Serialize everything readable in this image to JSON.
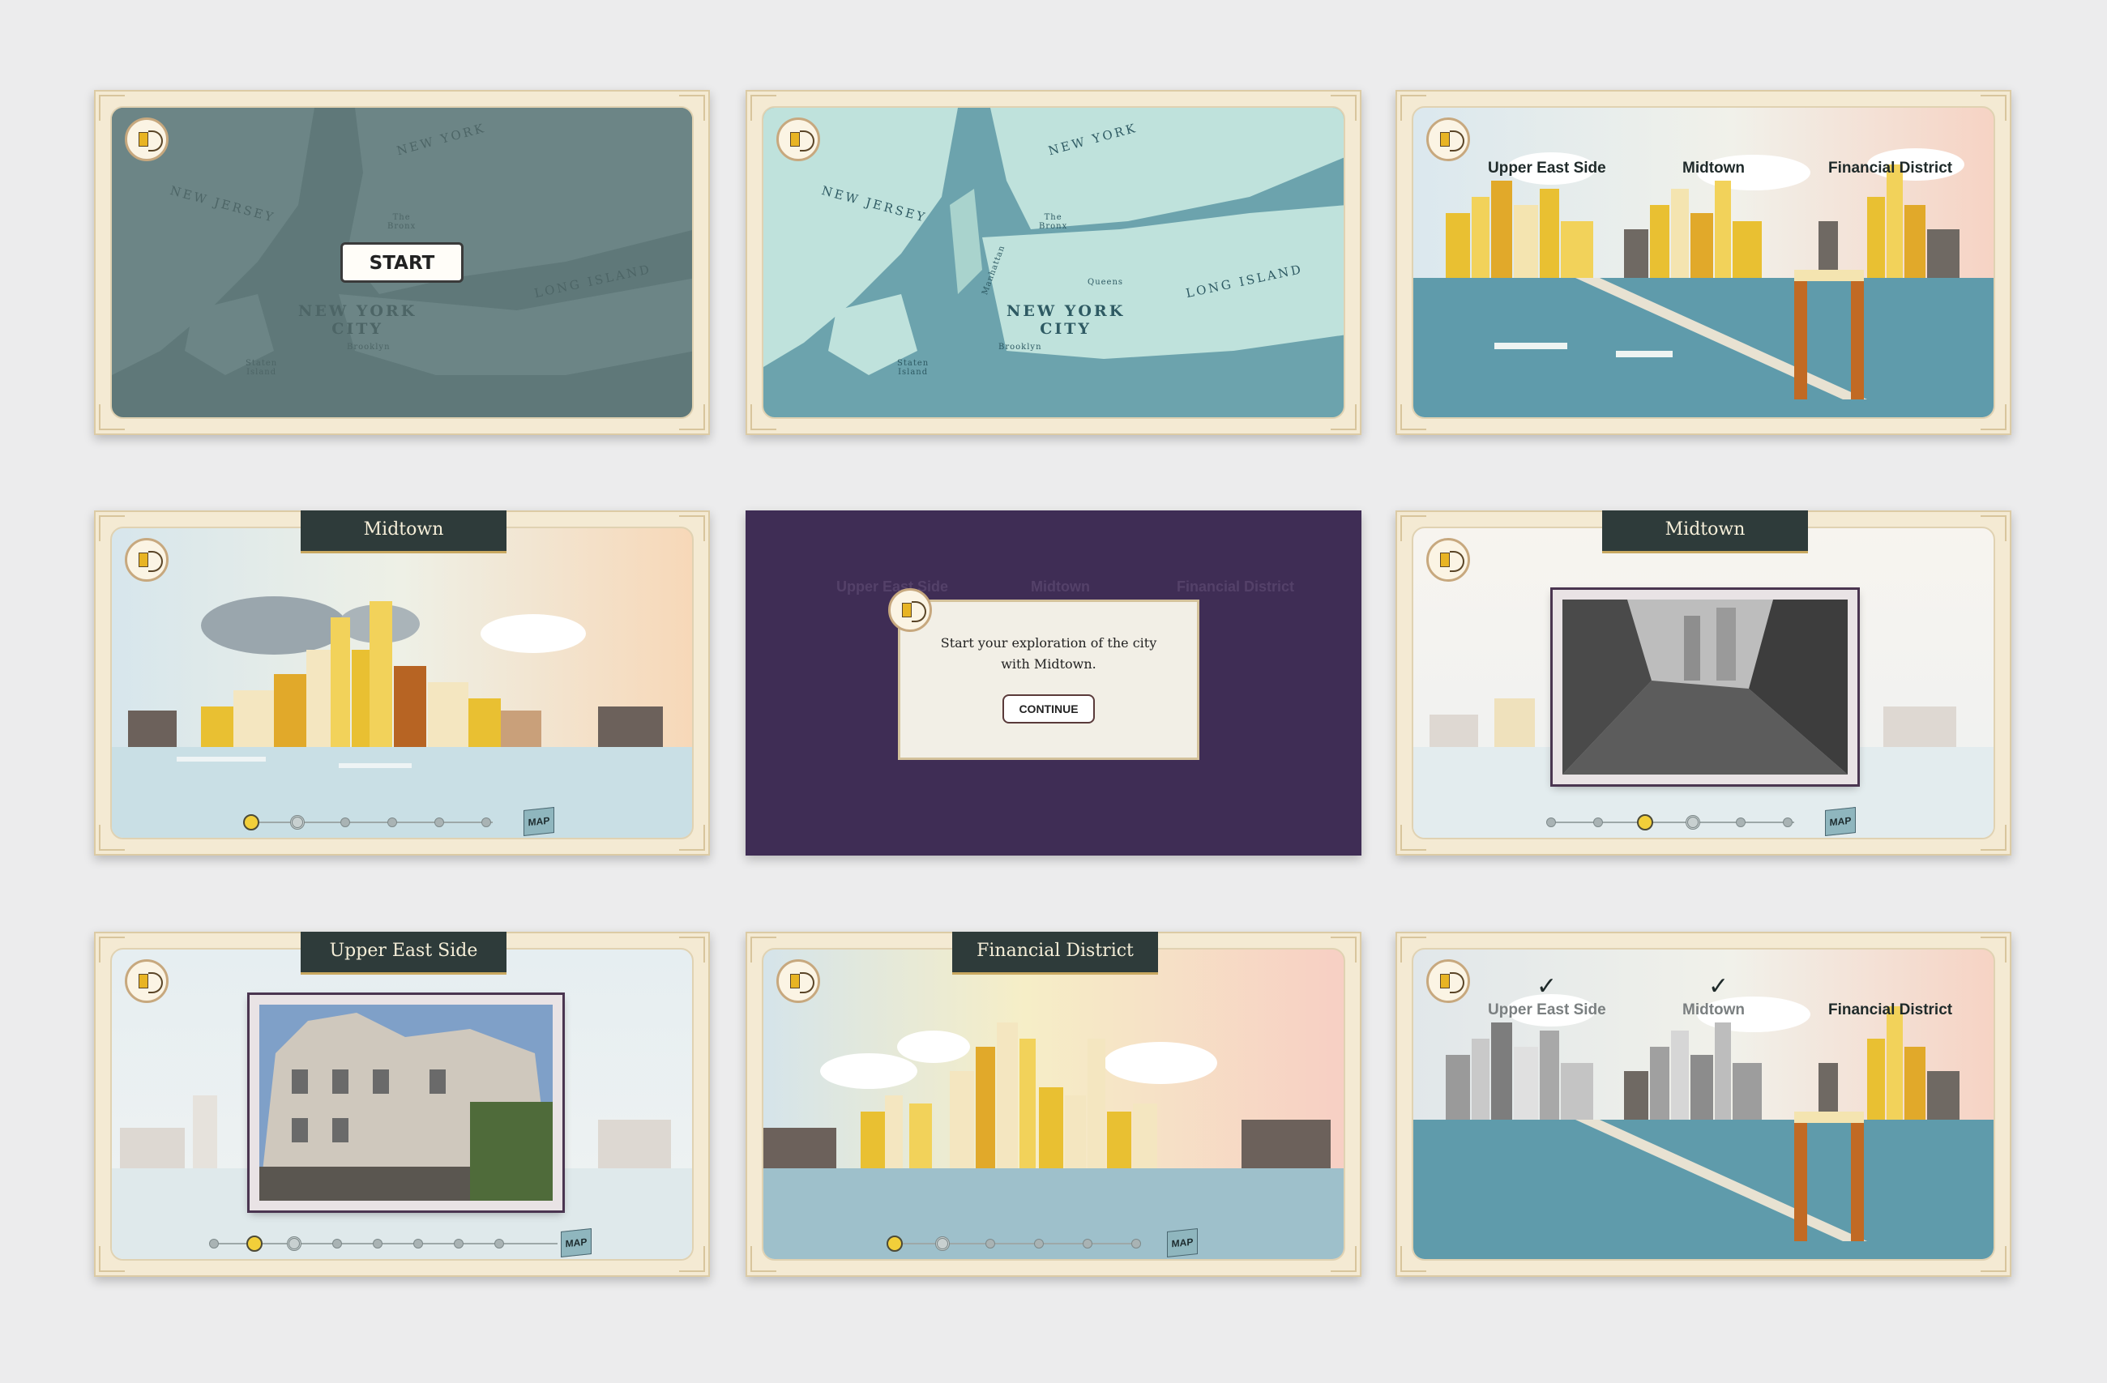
{
  "sound_icon": "speaker-volume-icon",
  "colors": {
    "frame": "#f4ead3",
    "title_tab": "#2e3b3a",
    "dialog_background": "#3f2d55",
    "active_dot": "#f2cf3a",
    "map_dark": "#5f7879",
    "map_light": "#bfe2dc"
  },
  "map_labels": {
    "new_york": "NEW YORK",
    "new_jersey": "NEW JERSEY",
    "long_island": "LONG ISLAND",
    "city_line1": "NEW YORK",
    "city_line2": "CITY",
    "bronx_line1": "The",
    "bronx_line2": "Bronx",
    "manhattan": "Manhattan",
    "queens": "Queens",
    "brooklyn": "Brooklyn",
    "staten_line1": "Staten",
    "staten_line2": "Island"
  },
  "start_button": "START",
  "districts": {
    "upper_east_side": "Upper East Side",
    "midtown": "Midtown",
    "financial_district": "Financial District"
  },
  "dialog": {
    "message": "Start your exploration of the city with Midtown.",
    "button": "CONTINUE"
  },
  "map_button": "MAP",
  "checkmark": "✓",
  "progress": {
    "midtown_intro": {
      "dots": 6,
      "active": 1
    },
    "midtown_photo": {
      "dots": 6,
      "active": 3
    },
    "upper_east_side": {
      "dots": 8,
      "active": 2
    },
    "financial_district": {
      "dots": 6,
      "active": 1
    }
  }
}
